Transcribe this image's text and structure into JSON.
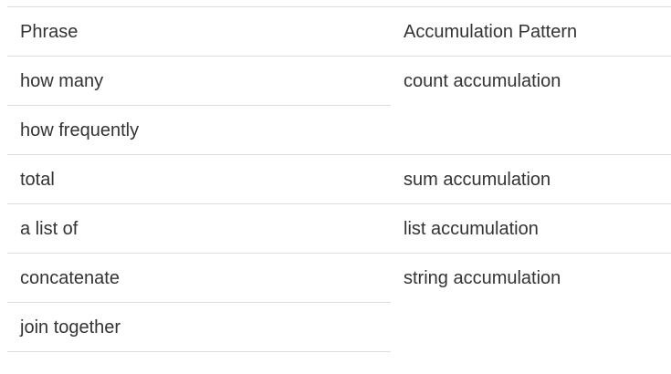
{
  "table": {
    "headers": [
      "Phrase",
      "Accumulation Pattern"
    ],
    "groups": [
      {
        "phrases": [
          "how many",
          "how frequently"
        ],
        "pattern": "count accumulation"
      },
      {
        "phrases": [
          "total"
        ],
        "pattern": "sum accumulation"
      },
      {
        "phrases": [
          "a list of"
        ],
        "pattern": "list accumulation"
      },
      {
        "phrases": [
          "concatenate",
          "join together"
        ],
        "pattern": "string accumulation"
      }
    ]
  }
}
